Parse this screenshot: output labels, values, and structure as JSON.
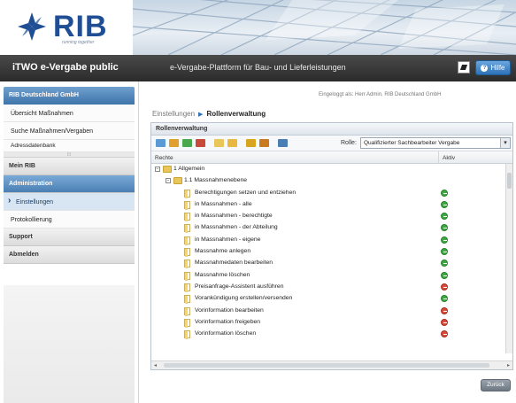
{
  "brand": {
    "logo_text": "RIB",
    "tagline": "running together"
  },
  "titlebar": {
    "app_title": "iTWO e-Vergabe public",
    "subtitle": "e-Vergabe-Plattform für Bau- und Lieferleistungen",
    "help_label": "Hilfe"
  },
  "sidebar": {
    "company": "RIB Deutschland GmbH",
    "items_top": [
      {
        "label": "Übersicht Maßnahmen"
      },
      {
        "label": "Suche Maßnahmen/Vergaben"
      },
      {
        "label": "Adressdatenbank"
      }
    ],
    "my_rib": "Mein RIB",
    "admin": "Administration",
    "admin_items": [
      {
        "label": "Einstellungen",
        "selected": true
      },
      {
        "label": "Protokollierung",
        "selected": false
      }
    ],
    "support": "Support",
    "logout": "Abmelden"
  },
  "main": {
    "logged_in": "Eingeloggt als: Herr Admin, RIB Deutschland GmbH",
    "breadcrumb": [
      "Einstellungen",
      "Rollenverwaltung"
    ],
    "panel_title": "Rollenverwaltung",
    "role_label": "Rolle:",
    "role_value": "Qualifizierter Sachbearbeiter Vergabe",
    "col_rechte": "Rechte",
    "col_aktiv": "Aktiv",
    "back_label": "Zurück"
  },
  "toolbar_icons": [
    "user-add-icon",
    "user-edit-icon",
    "user-copy-icon",
    "user-delete-icon",
    "folder-icon",
    "folder-open-icon",
    "key-add-icon",
    "key-remove-icon",
    "export-icon"
  ],
  "tree": [
    {
      "label": "1 Allgemein",
      "level": 0,
      "type": "folder",
      "status": null
    },
    {
      "label": "1.1 Massnahmenebene",
      "level": 1,
      "type": "folder",
      "status": null
    },
    {
      "label": "Berechtigungen setzen und entziehen",
      "level": 2,
      "type": "doc",
      "status": "ok"
    },
    {
      "label": "in Massnahmen - alle",
      "level": 2,
      "type": "doc",
      "status": "ok"
    },
    {
      "label": "in Massnahmen - berechtigte",
      "level": 2,
      "type": "doc",
      "status": "ok"
    },
    {
      "label": "in Massnahmen - der Abteilung",
      "level": 2,
      "type": "doc",
      "status": "ok"
    },
    {
      "label": "in Massnahmen - eigene",
      "level": 2,
      "type": "doc",
      "status": "ok"
    },
    {
      "label": "Massnahme anlegen",
      "level": 2,
      "type": "doc",
      "status": "ok"
    },
    {
      "label": "Massnahmedaten bearbeiten",
      "level": 2,
      "type": "doc",
      "status": "ok"
    },
    {
      "label": "Massnahme löschen",
      "level": 2,
      "type": "doc",
      "status": "ok"
    },
    {
      "label": "Preisanfrage-Assistent ausführen",
      "level": 2,
      "type": "doc",
      "status": "no"
    },
    {
      "label": "Vorankündigung erstellen/versenden",
      "level": 2,
      "type": "doc",
      "status": "ok"
    },
    {
      "label": "Vorinformation bearbeiten",
      "level": 2,
      "type": "doc",
      "status": "no"
    },
    {
      "label": "Vorinformation freigeben",
      "level": 2,
      "type": "doc",
      "status": "no"
    },
    {
      "label": "Vorinformation löschen",
      "level": 2,
      "type": "doc",
      "status": "no"
    }
  ],
  "colors": {
    "accent": "#2d72b8",
    "status_ok": "#3ea842",
    "status_no": "#d84a3a"
  }
}
